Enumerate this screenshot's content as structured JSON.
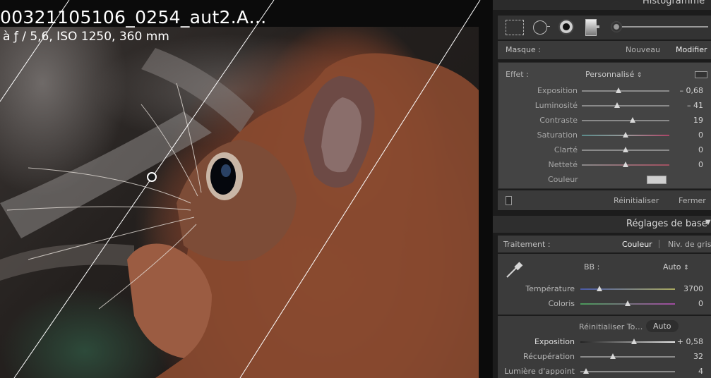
{
  "photo": {
    "title": "00321105106_0254_aut2.A…",
    "subtitle": "à ƒ / 5,6, ISO 1250, 360 mm"
  },
  "panel": {
    "histogram_header": "Histogramme",
    "mask": {
      "label": "Masque :",
      "new": "Nouveau",
      "edit": "Modifier"
    },
    "effect": {
      "label": "Effet :",
      "preset": "Personnalisé",
      "sliders": [
        {
          "label": "Exposition",
          "value": "– 0,68",
          "pos": 0.42
        },
        {
          "label": "Luminosité",
          "value": "– 41",
          "pos": 0.4
        },
        {
          "label": "Contraste",
          "value": "19",
          "pos": 0.58
        },
        {
          "label": "Saturation",
          "value": "0",
          "pos": 0.5
        },
        {
          "label": "Clarté",
          "value": "0",
          "pos": 0.5
        },
        {
          "label": "Netteté",
          "value": "0",
          "pos": 0.5
        }
      ],
      "color_label": "Couleur",
      "reset": "Réinitialiser",
      "close": "Fermer"
    },
    "basic": {
      "header": "Réglages de base",
      "treatment_label": "Traitement :",
      "color": "Couleur",
      "grayscale": "Niv. de gris",
      "wb_label": "BB :",
      "wb_value": "Auto",
      "temperature": {
        "label": "Température",
        "value": "3700",
        "pos": 0.2
      },
      "tint": {
        "label": "Coloris",
        "value": "0",
        "pos": 0.5
      },
      "tone_reset": "Réinitialiser To…",
      "tone_auto": "Auto",
      "exposure": {
        "label": "Exposition",
        "value": "+ 0,58",
        "pos": 0.57
      },
      "recovery": {
        "label": "Récupération",
        "value": "32",
        "pos": 0.34
      },
      "fill_light": {
        "label": "Lumière d'appoint",
        "value": "4",
        "pos": 0.06
      }
    }
  }
}
